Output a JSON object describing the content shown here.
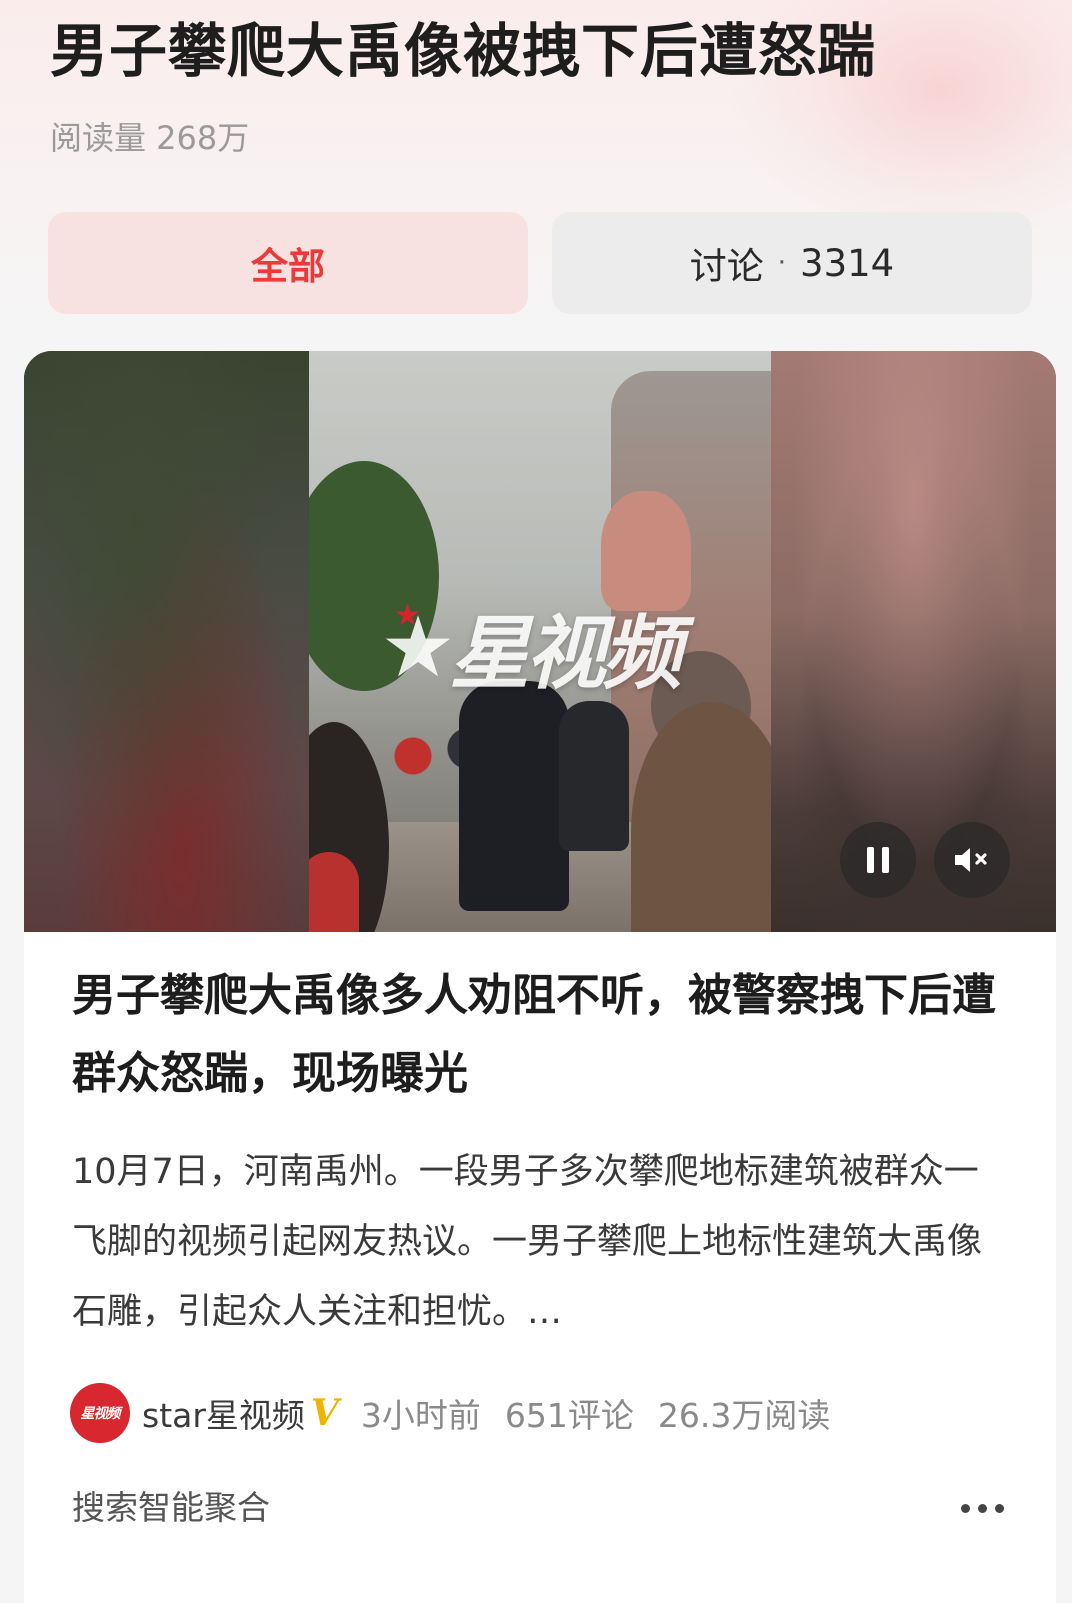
{
  "header": {
    "title": "男子攀爬大禹像被拽下后遭怒踹",
    "read_count": "阅读量 268万"
  },
  "tabs": [
    {
      "label": "全部",
      "active": true
    },
    {
      "label": "讨论",
      "count": "3314",
      "separator": "·",
      "active": false
    }
  ],
  "video": {
    "watermark": "星视频",
    "pause_icon": "pause-icon",
    "mute_icon": "volume-mute-icon"
  },
  "article": {
    "title": "男子攀爬大禹像多人劝阻不听，被警察拽下后遭群众怒踹，现场曝光",
    "summary": "10月7日，河南禹州。一段男子多次攀爬地标建筑被群众一飞脚的视频引起网友热议。一男子攀爬上地标性建筑大禹像石雕，引起众人关注和担忧。…",
    "source": "star星视频",
    "verified_mark": "V",
    "time": "3小时前",
    "comments": "651评论",
    "reads": "26.3万阅读",
    "avatar_text": "星视频"
  },
  "footer": {
    "aggregate_label": "搜索智能聚合",
    "more_icon": "more-dots-icon"
  },
  "colors": {
    "accent_red": "#ec3a3a",
    "verified_gold": "#f0b400"
  }
}
